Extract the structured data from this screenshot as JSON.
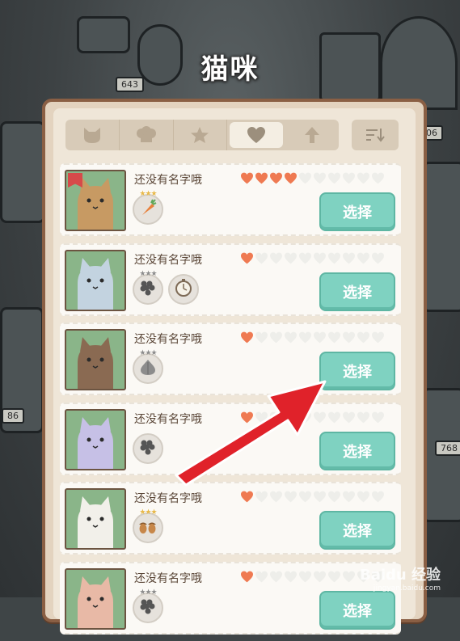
{
  "screen": {
    "title": "猫咪"
  },
  "background_tags": [
    "643",
    "06",
    "768",
    "86"
  ],
  "tabs": [
    {
      "name": "cat-icon",
      "active": false
    },
    {
      "name": "chef-hat-icon",
      "active": false
    },
    {
      "name": "star-icon",
      "active": false
    },
    {
      "name": "heart-icon",
      "active": true
    },
    {
      "name": "arrow-up-icon",
      "active": false
    }
  ],
  "sort_button": {
    "icon": "sort-icon"
  },
  "cats": [
    {
      "name": "还没有名字哦",
      "hearts_filled": 4,
      "hearts_total": 10,
      "select_label": "选择",
      "favorite": true,
      "fur": "#c79a63",
      "items": [
        {
          "icon": "carrot-icon",
          "stars": "★★★",
          "grey": false
        }
      ]
    },
    {
      "name": "还没有名字哦",
      "hearts_filled": 1,
      "hearts_total": 10,
      "select_label": "选择",
      "favorite": false,
      "fur": "#c3d3e0",
      "items": [
        {
          "icon": "grapes-icon",
          "stars": "★★★",
          "grey": true
        },
        {
          "icon": "pocket-watch-icon",
          "stars": "",
          "grey": false
        }
      ]
    },
    {
      "name": "还没有名字哦",
      "hearts_filled": 1,
      "hearts_total": 10,
      "select_label": "选择",
      "favorite": false,
      "fur": "#8a6a52",
      "items": [
        {
          "icon": "onion-icon",
          "stars": "★★★",
          "grey": true
        }
      ]
    },
    {
      "name": "还没有名字哦",
      "hearts_filled": 1,
      "hearts_total": 10,
      "select_label": "选择",
      "favorite": false,
      "fur": "#c6c0e6",
      "items": [
        {
          "icon": "grapes-icon",
          "stars": "",
          "grey": false
        }
      ]
    },
    {
      "name": "还没有名字哦",
      "hearts_filled": 1,
      "hearts_total": 10,
      "select_label": "选择",
      "favorite": false,
      "fur": "#f2f0ea",
      "items": [
        {
          "icon": "acorn-icon",
          "stars": "★★★",
          "grey": false
        }
      ]
    },
    {
      "name": "还没有名字哦",
      "hearts_filled": 1,
      "hearts_total": 10,
      "select_label": "选择",
      "favorite": false,
      "fur": "#e8b9a6",
      "items": [
        {
          "icon": "grapes-icon",
          "stars": "★★★",
          "grey": true
        }
      ]
    }
  ],
  "colors": {
    "heart_filled": "#ef7a52",
    "heart_empty": "#eeeeea",
    "select_button": "#7fd2c1",
    "panel_border": "#8a5f44",
    "annotation_arrow": "#e0222a"
  },
  "watermark": {
    "line1": "Baidu 经验",
    "line2": "jingyan.baidu.com"
  }
}
